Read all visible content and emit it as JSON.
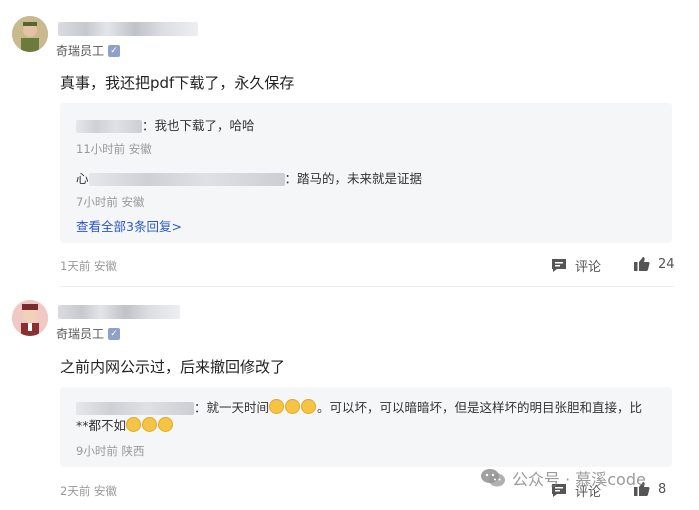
{
  "comments": [
    {
      "role": "奇瑞员工",
      "content": "真事，我还把pdf下载了，永久保存",
      "replies": [
        {
          "text_suffix": "：我也下载了，哈哈",
          "meta": "11小时前 安徽"
        },
        {
          "text_prefix": "心",
          "text_suffix": "：踏马的，未来就是证据",
          "meta": "7小时前 安徽"
        }
      ],
      "view_all": "查看全部3条回复>",
      "meta": "1天前 安徽",
      "comment_label": "评论",
      "like_count": "24"
    },
    {
      "role": "奇瑞员工",
      "content": "之前内网公示过，后来撤回修改了",
      "replies": [
        {
          "text_suffix": "：就一天时间",
          "text_mid": "。可以坏，可以暗暗坏，但是这样坏的明目张胆和直接，比",
          "line2_prefix": "**都不如",
          "meta": "9小时前 陕西"
        }
      ],
      "meta": "2天前 安徽",
      "comment_label": "评论",
      "like_count": "8"
    }
  ],
  "watermark": "公众号 · 慕溪code",
  "colors": {
    "link": "#2a56c6",
    "reply_bg": "#f5f6f8",
    "meta": "#999999"
  }
}
